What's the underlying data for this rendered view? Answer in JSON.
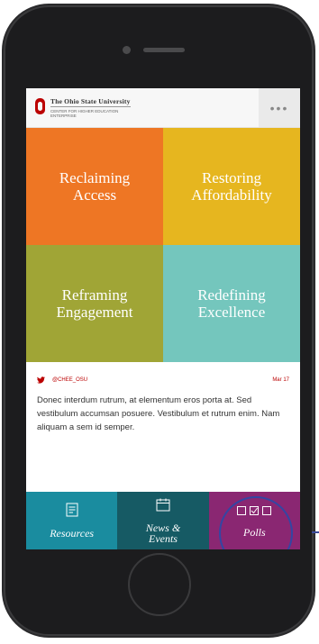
{
  "header": {
    "title": "The Ohio State University",
    "subtitle": "Center for Higher Education Enterprise",
    "menu_icon": "more-dots-icon"
  },
  "tiles": [
    {
      "label_line1": "Reclaiming",
      "label_line2": "Access",
      "color": "#ee7624"
    },
    {
      "label_line1": "Restoring",
      "label_line2": "Affordability",
      "color": "#e6b61f"
    },
    {
      "label_line1": "Reframing",
      "label_line2": "Engagement",
      "color": "#a0a536"
    },
    {
      "label_line1": "Redefining",
      "label_line2": "Excellence",
      "color": "#74c6bd"
    }
  ],
  "feed": {
    "icon": "twitter-icon",
    "handle": "@CHEE_OSU",
    "date": "Mar 17",
    "text": "Donec interdum rutrum, at elementum eros porta at. Sed vestibulum accumsan posuere. Vestibulum et rutrum enim. Nam aliquam a sem id semper."
  },
  "nav": [
    {
      "label_line1": "Resources",
      "label_line2": "",
      "icon": "document-icon",
      "color": "#1a8c9f"
    },
    {
      "label_line1": "News &",
      "label_line2": "Events",
      "icon": "calendar-icon",
      "color": "#165a64"
    },
    {
      "label_line1": "Polls",
      "label_line2": "",
      "icon": "checkbox-icon",
      "color": "#8a2772"
    }
  ],
  "colors": {
    "brand": "#bb0000",
    "highlight_ring": "#3346a3"
  }
}
